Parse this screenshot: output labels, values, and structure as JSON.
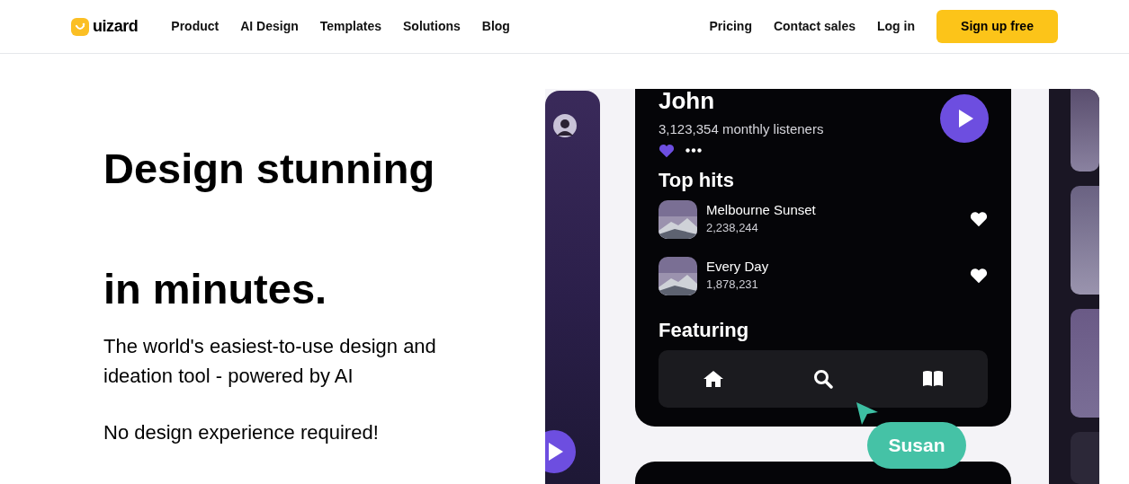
{
  "nav": {
    "logo": "uizard",
    "links": [
      "Product",
      "AI Design",
      "Templates",
      "Solutions",
      "Blog"
    ],
    "right_links": [
      "Pricing",
      "Contact sales",
      "Log in"
    ],
    "cta": "Sign up free"
  },
  "hero": {
    "title_lines": [
      "Design stunning",
      "in minutes."
    ],
    "description": "The world's easiest-to-use design and ideation tool - powered by AI",
    "note": "No design experience required!"
  },
  "mockup": {
    "artist": "John",
    "listeners": "3,123,354 monthly listeners",
    "section_title": "Top hits",
    "tracks": [
      {
        "title": "Melbourne Sunset",
        "plays": "2,238,244"
      },
      {
        "title": "Every Day",
        "plays": "1,878,231"
      }
    ],
    "featuring": "Featuring",
    "cursor_label": "Susan"
  }
}
